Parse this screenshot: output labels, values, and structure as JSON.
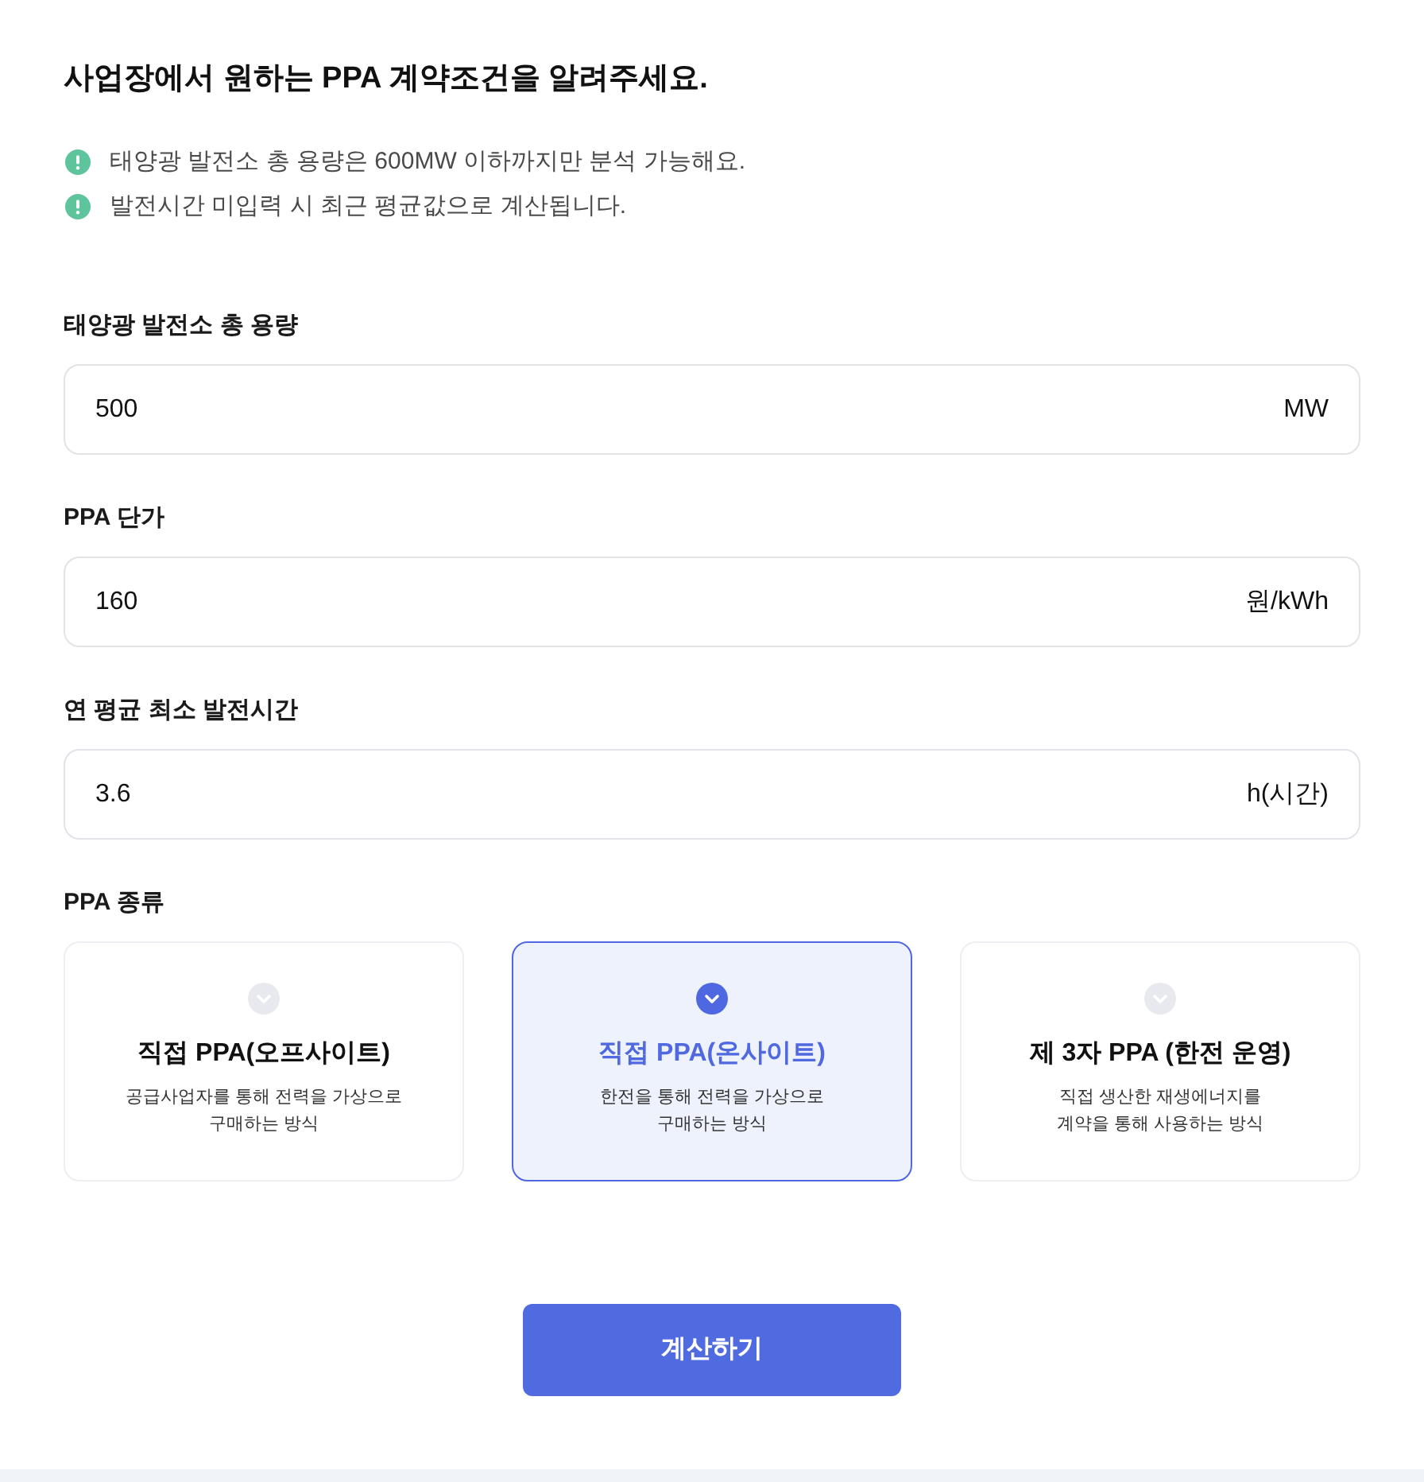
{
  "title": "사업장에서 원하는 PPA 계약조건을 알려주세요.",
  "notices": [
    "태양광 발전소 총 용량은 600MW 이하까지만 분석 가능해요.",
    "발전시간 미입력 시 최근 평균값으로 계산됩니다."
  ],
  "fields": [
    {
      "label": "태양광 발전소 총 용량",
      "value": "500",
      "unit": "MW"
    },
    {
      "label": "PPA 단가",
      "value": "160",
      "unit": "원/kWh"
    },
    {
      "label": "연 평균 최소 발전시간",
      "value": "3.6",
      "unit": "h(시간)"
    }
  ],
  "ppa_type": {
    "label": "PPA 종류",
    "options": [
      {
        "title": "직접 PPA(오프사이트)",
        "description": [
          "공급사업자를 통해 전력을 가상으로",
          "구매하는 방식"
        ],
        "selected": false
      },
      {
        "title": "직접 PPA(온사이트)",
        "description": [
          "한전을 통해 전력을 가상으로",
          "구매하는 방식"
        ],
        "selected": true
      },
      {
        "title": "제 3자 PPA (한전 운영)",
        "description": [
          "직접 생산한 재생에너지를",
          "계약을 통해 사용하는 방식"
        ],
        "selected": false
      }
    ]
  },
  "submit_button": "계산하기"
}
